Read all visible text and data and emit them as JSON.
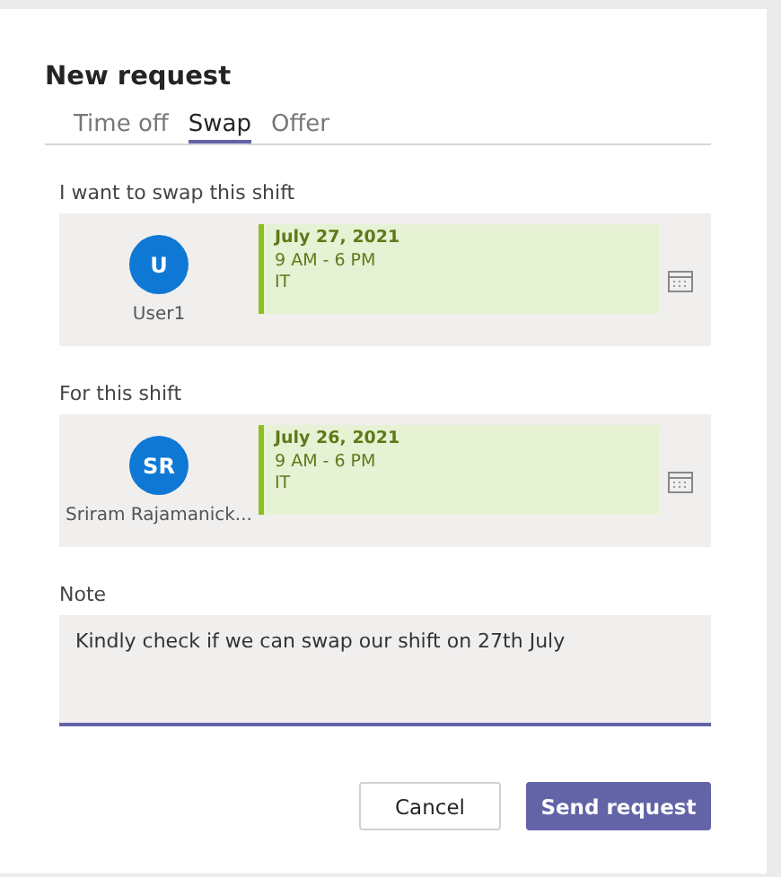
{
  "title": "New request",
  "tabs": [
    {
      "label": "Time off",
      "selected": false
    },
    {
      "label": "Swap",
      "selected": true
    },
    {
      "label": "Offer",
      "selected": false
    }
  ],
  "shifts": [
    {
      "label": "I want to swap this shift",
      "user": {
        "initials": "U",
        "name": "User1"
      },
      "date": "July 27, 2021",
      "time": "9 AM - 6 PM",
      "group": "IT"
    },
    {
      "label": "For this shift",
      "user": {
        "initials": "SR",
        "name": "Sriram Rajamanick..."
      },
      "date": "July 26, 2021",
      "time": "9 AM - 6 PM",
      "group": "IT"
    }
  ],
  "note": {
    "label": "Note",
    "value": "Kindly check if we can swap our shift on 27th July"
  },
  "buttons": [
    {
      "label": "Cancel",
      "kind": "secondary"
    },
    {
      "label": "Send request",
      "kind": "primary"
    }
  ]
}
